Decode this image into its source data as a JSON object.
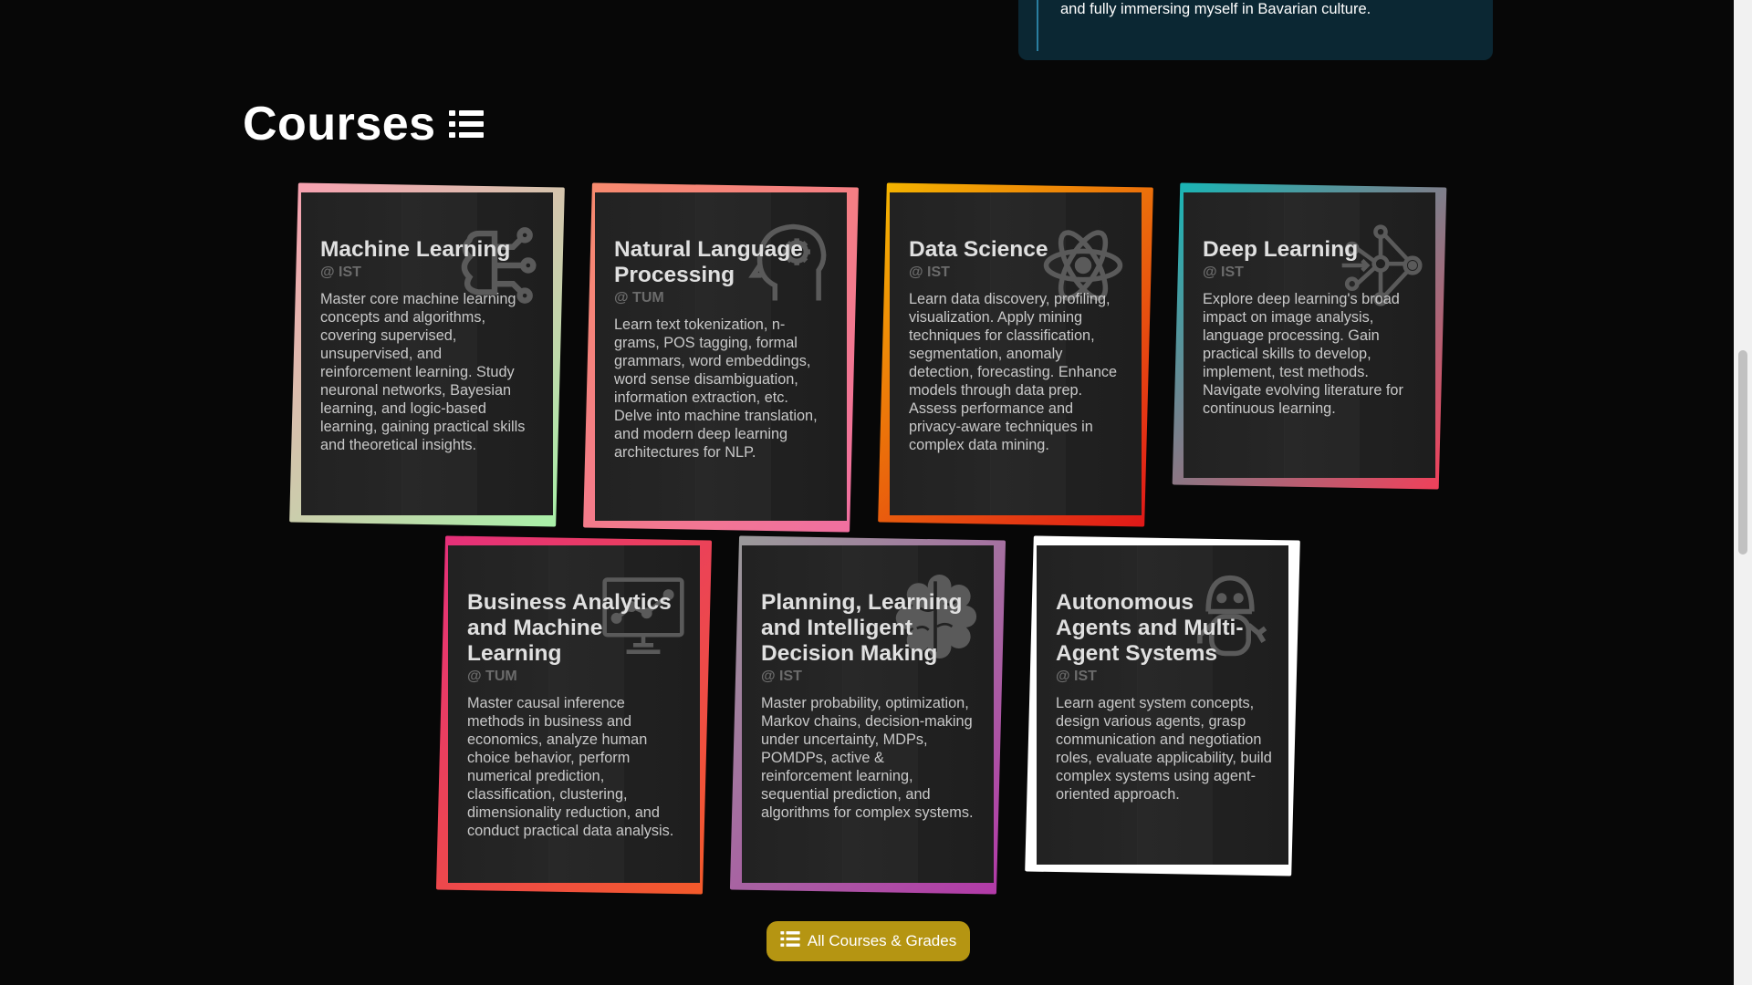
{
  "top_card": {
    "text": "Munich, connecting with students from around the world and fully immersing myself in Bavarian culture."
  },
  "section": {
    "title": "Courses",
    "icon": "list-icon"
  },
  "courses": [
    {
      "title": "Machine Learning",
      "institution": "@ IST",
      "icon": "neural-network-icon",
      "description": "Master core machine learning concepts and algorithms, covering supervised, unsupervised, and reinforcement learning. Study neuronal networks, Bayesian learning, and logic-based learning, gaining practical skills and theoretical insights.",
      "frame_colors": [
        "#f7a1b0",
        "#a8f0a8"
      ]
    },
    {
      "title": "Natural Language Processing",
      "institution": "@ TUM",
      "icon": "head-gear-icon",
      "description": "Learn text tokenization, n-grams, POS tagging, formal grammars, word embeddings, word sense disambiguation, information extraction, etc. Delve into machine translation, and modern deep learning architectures for NLP.",
      "frame_colors": [
        "#f78a6e",
        "#f06fa0"
      ]
    },
    {
      "title": "Data Science",
      "institution": "@ IST",
      "icon": "atom-icon",
      "description": "Learn data discovery, profiling, visualization. Apply mining techniques for classification, segmentation, anomaly detection, forecasting. Enhance models through data prep. Assess performance and privacy-aware techniques in complex data mining.",
      "frame_colors": [
        "#f4b400",
        "#e01818"
      ]
    },
    {
      "title": "Deep Learning",
      "institution": "@ IST",
      "icon": "network-graph-icon",
      "description": "Explore deep learning's broad impact on image analysis, language processing. Gain practical skills to develop, implement, test methods. Navigate evolving literature for continuous learning.",
      "frame_colors": [
        "#19b5b5",
        "#f0405a"
      ]
    },
    {
      "title": "Business Analytics and Machine Learning",
      "institution": "@ TUM",
      "icon": "chart-monitor-icon",
      "description": "Master causal inference methods in business and economics, analyze human choice behavior, perform numerical prediction, classification, clustering, dimensionality reduction, and conduct practical data analysis.",
      "frame_colors": [
        "#e5307a",
        "#f35a2a"
      ]
    },
    {
      "title": "Planning, Learning and Intelligent Decision Making",
      "institution": "@ IST",
      "icon": "brain-icon",
      "description": "Master probability, optimization, Markov chains, decision-making under uncertainty, MDPs, POMDPs, active & reinforcement learning, sequential prediction, and algorithms for complex systems.",
      "frame_colors": [
        "#9a9a9a",
        "#b23aa8"
      ]
    },
    {
      "title": "Autonomous Agents and Multi-Agent Systems",
      "institution": "@ IST",
      "icon": "robot-icon",
      "description": "Learn agent system concepts, design various agents, grasp communication and negotiation roles, evaluate applicability, build complex systems using agent-oriented approach.",
      "frame_colors": [
        "#ffffff",
        "#ffffff"
      ]
    }
  ],
  "all_courses_button": {
    "label": "All Courses & Grades",
    "icon": "list-icon",
    "color": "#b59512"
  }
}
